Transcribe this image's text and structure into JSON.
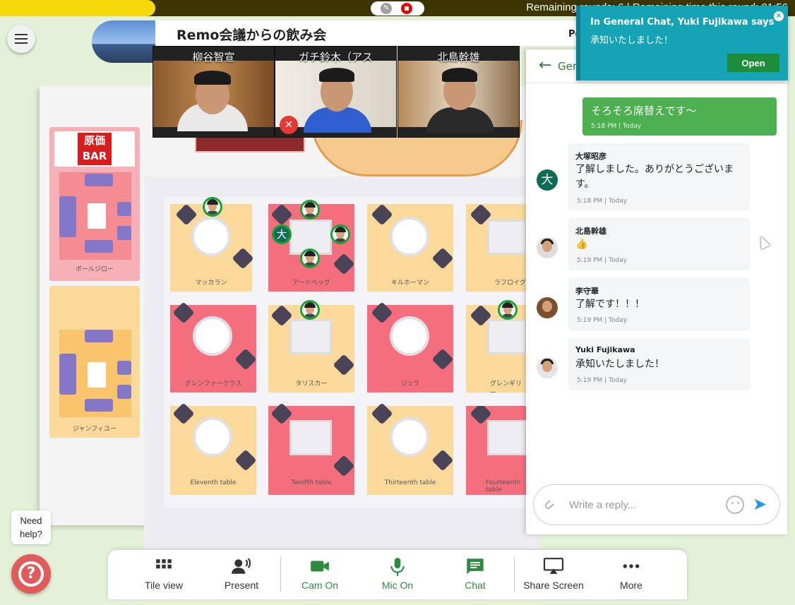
{
  "topbar": {
    "round_text": "Remaining rounds: 6 | Remaining time this round: 01:56"
  },
  "event": {
    "title": "Remo会議からの飲み会",
    "header_partial": "Po"
  },
  "videos": [
    {
      "name": "柳谷智宣",
      "muted": false
    },
    {
      "name": "ガチ鈴木（アス",
      "muted": true
    },
    {
      "name": "北島幹雄",
      "muted": false
    }
  ],
  "bar_sign": {
    "line1": "原価",
    "line2": "BAR"
  },
  "rooms": {
    "side": [
      "ポールジロー",
      "ジャンフィユー"
    ],
    "tables": [
      "マッカラン",
      "アードベッグ",
      "キルホーマン",
      "ラフロイグ",
      "グレンファークラス",
      "タリスカー",
      "ジュラ",
      "グレンギリー",
      "Eleventh table",
      "Twelfth table",
      "Thirteenth table",
      "Fourteenth table"
    ]
  },
  "chat": {
    "header_title": "Gen",
    "outgoing": {
      "text": "そろそろ席替えです〜",
      "time": "5:18 PM | Today"
    },
    "messages": [
      {
        "sender": "大塚昭彦",
        "avatar_letter": "大",
        "text": "了解しました。ありがとうございます。",
        "time": "5:18 PM | Today"
      },
      {
        "sender": "北島幹雄",
        "text": "👍",
        "time": "5:19 PM | Today"
      },
      {
        "sender": "李守華",
        "text": "了解です！！！",
        "time": "5:19 PM | Today"
      },
      {
        "sender": "Yuki Fujikawa",
        "text": "承知いたしました！",
        "time": "5:19 PM | Today"
      }
    ],
    "reply_placeholder": "Write a reply..."
  },
  "toast": {
    "title": "In General Chat, Yuki Fujikawa says",
    "body": "承知いたしました！",
    "open_label": "Open"
  },
  "toolbar": {
    "tile_view": "Tile view",
    "present": "Present",
    "cam_on": "Cam On",
    "mic_on": "Mic On",
    "chat": "Chat",
    "share_screen": "Share Screen",
    "more": "More"
  },
  "help": {
    "label": "Need help?"
  },
  "colors": {
    "green": "#2e8b3d",
    "toast": "#15a3b6",
    "topbar": "#3d3400",
    "accent_yellow": "#f5d90a"
  }
}
